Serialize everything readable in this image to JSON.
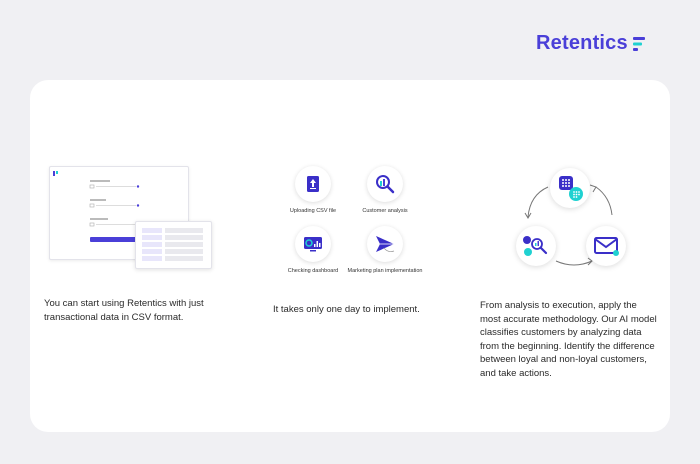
{
  "brand": {
    "name": "Retentics"
  },
  "columns": [
    {
      "description": "You can start using Retentics with just transactional data in CSV format."
    },
    {
      "description": "It takes only one day to implement."
    },
    {
      "description": "From analysis to execution, apply the most accurate methodology. Our AI model classifies customers by analyzing data from the beginning. Identify the difference between loyal and non-loyal customers, and take actions."
    }
  ],
  "features": [
    {
      "label": "Uploading CSV file",
      "icon": "upload-file-icon"
    },
    {
      "label": "Customer analysis",
      "icon": "magnifier-icon"
    },
    {
      "label": "Checking dashboard",
      "icon": "dashboard-icon"
    },
    {
      "label": "Marketing plan implementation",
      "icon": "paper-plane-icon"
    }
  ],
  "cycle": {
    "nodes": [
      "segments-grid-icon",
      "mail-icon",
      "analysis-icon"
    ]
  },
  "colors": {
    "accent": "#4a3fd8",
    "teal": "#1fd1d1",
    "card": "#ffffff",
    "background": "#f0f0f3"
  }
}
